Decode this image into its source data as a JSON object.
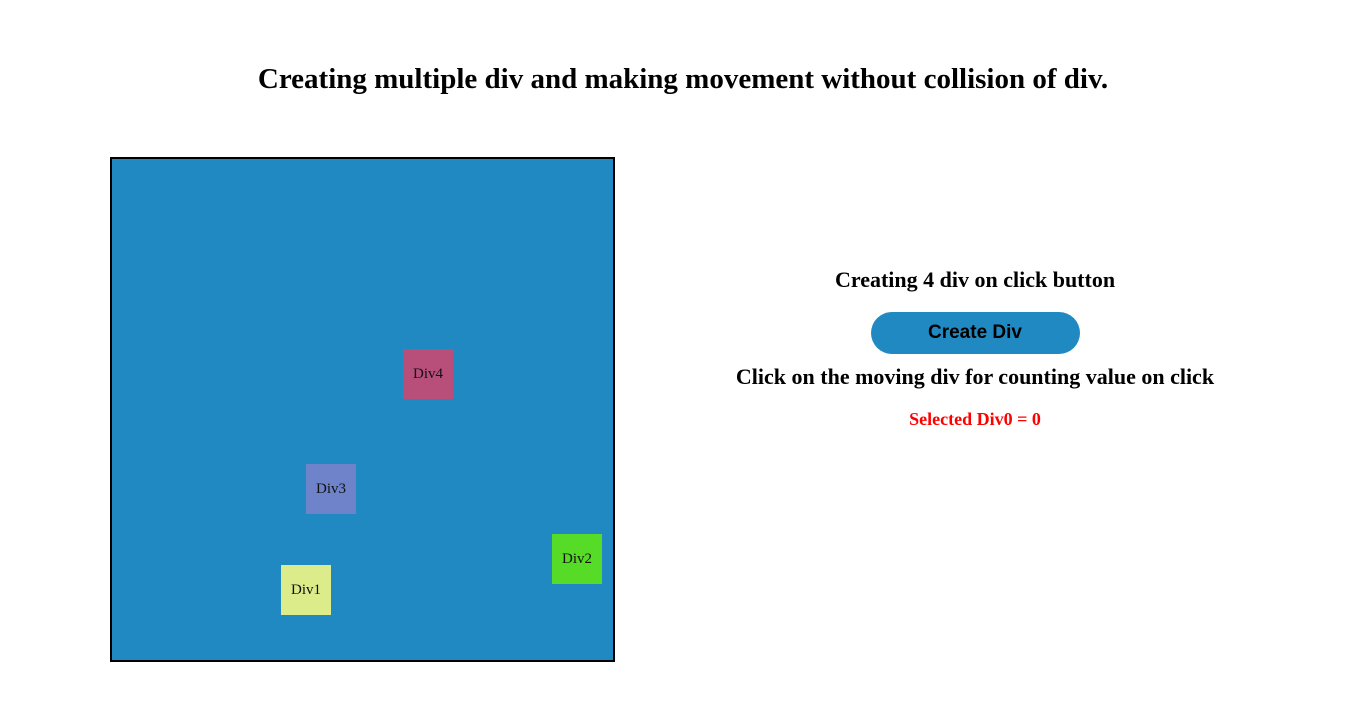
{
  "page": {
    "title": "Creating multiple div and making movement without collision of div."
  },
  "arena": {
    "background": "#2189c1",
    "border_color": "#000000",
    "divs": [
      {
        "id": "div1",
        "label": "Div1",
        "color": "#dcec8b"
      },
      {
        "id": "div2",
        "label": "Div2",
        "color": "#56db26"
      },
      {
        "id": "div3",
        "label": "Div3",
        "color": "#6f83cb"
      },
      {
        "id": "div4",
        "label": "Div4",
        "color": "#b84f7b"
      }
    ]
  },
  "panel": {
    "heading": "Creating 4 div on click button",
    "create_button_label": "Create Div",
    "instruction": "Click on the moving div for counting value on click",
    "selected_status": "Selected Div0 = 0",
    "selected_status_color": "#ff0000"
  }
}
